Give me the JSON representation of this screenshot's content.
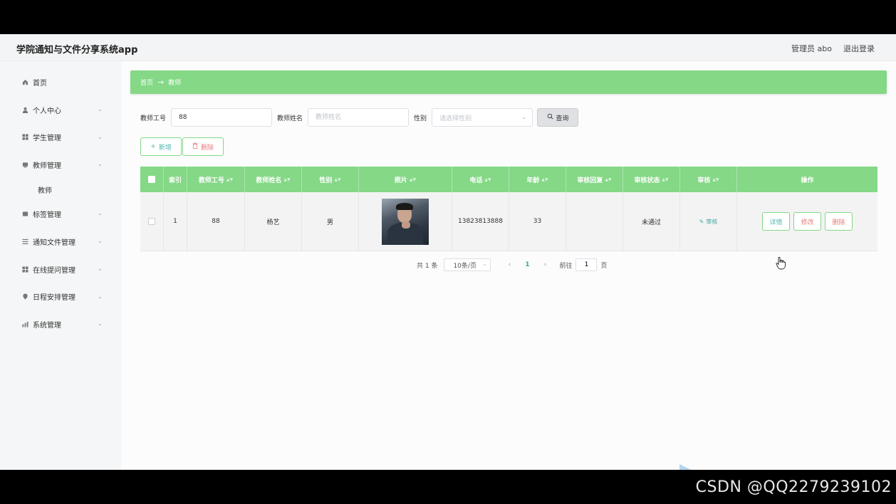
{
  "app": {
    "title": "学院通知与文件分享系统app",
    "user_label": "管理员 abo",
    "logout_label": "退出登录"
  },
  "sidebar": {
    "items": [
      {
        "label": "首页",
        "icon": "home-icon",
        "has_children": false
      },
      {
        "label": "个人中心",
        "icon": "user-icon",
        "has_children": true
      },
      {
        "label": "学生管理",
        "icon": "grid-icon",
        "has_children": true
      },
      {
        "label": "教师管理",
        "icon": "folder-icon",
        "has_children": true,
        "expanded": true,
        "children": [
          {
            "label": "教师"
          }
        ]
      },
      {
        "label": "标签管理",
        "icon": "tag-icon",
        "has_children": true
      },
      {
        "label": "通知文件管理",
        "icon": "list-icon",
        "has_children": true
      },
      {
        "label": "在线提问管理",
        "icon": "grid-icon",
        "has_children": true
      },
      {
        "label": "日程安排管理",
        "icon": "pin-icon",
        "has_children": true
      },
      {
        "label": "系统管理",
        "icon": "chart-icon",
        "has_children": true
      }
    ]
  },
  "breadcrumb": {
    "home": "首页",
    "separator": "→",
    "current": "教师"
  },
  "search": {
    "teacher_id_label": "教师工号",
    "teacher_id_value": "88",
    "teacher_name_label": "教师姓名",
    "teacher_name_placeholder": "教师姓名",
    "gender_label": "性别",
    "gender_placeholder": "请选择性别",
    "query_label": "查询"
  },
  "actions": {
    "add_label": "新增",
    "delete_label": "删除"
  },
  "table": {
    "columns": [
      "索引",
      "教师工号",
      "教师姓名",
      "性别",
      "照片",
      "电话",
      "年龄",
      "审核回复",
      "审核状态",
      "审核",
      "操作"
    ],
    "rows": [
      {
        "index": "1",
        "teacher_id": "88",
        "teacher_name": "杨艺",
        "gender": "男",
        "phone": "13823813888",
        "age": "33",
        "audit_reply": "",
        "audit_status": "未通过",
        "audit_action": "审核",
        "ops": {
          "detail": "详情",
          "edit": "修改",
          "delete": "删除"
        }
      }
    ]
  },
  "pagination": {
    "total_text": "共 1 条",
    "page_size": "10条/页",
    "current_page": "1",
    "goto_label": "前往",
    "goto_value": "1",
    "page_unit": "页"
  },
  "watermark": "CSDN @QQ2279239102",
  "colors": {
    "accent_green": "#84d886",
    "teal_text": "#51b7b0",
    "danger_text": "#e67c7c"
  }
}
